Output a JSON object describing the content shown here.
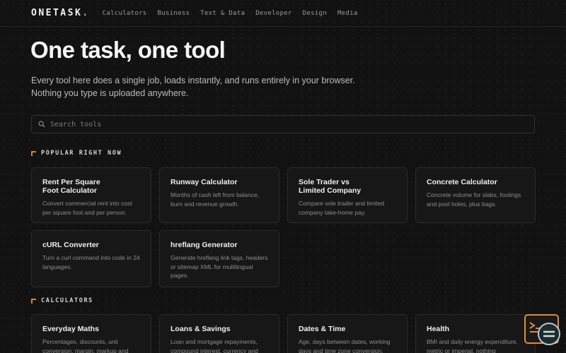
{
  "header": {
    "logo": "ONETASK",
    "logo_dot": ".",
    "nav": [
      "Calculators",
      "Business",
      "Text & Data",
      "Developer",
      "Design",
      "Media"
    ]
  },
  "hero": {
    "title": "One task, one tool",
    "subtitle": "Every tool here does a single job, loads instantly, and runs entirely in your browser. Nothing you type is uploaded anywhere."
  },
  "search": {
    "placeholder": "Search tools",
    "value": ""
  },
  "sections": [
    {
      "label": "POPULAR RIGHT NOW",
      "cards": [
        {
          "title": "Rent Per Square Foot Calculator",
          "desc": "Convert commercial rent into cost per square foot and per person."
        },
        {
          "title": "Runway Calculator",
          "desc": "Months of cash left from balance, burn and revenue growth."
        },
        {
          "title": "Sole Trader vs Limited Company",
          "desc": "Compare sole trader and limited company take-home pay."
        },
        {
          "title": "Concrete Calculator",
          "desc": "Concrete volume for slabs, footings and post holes, plus bags."
        },
        {
          "title": "cURL Converter",
          "desc": "Turn a curl command into code in 24 languages."
        },
        {
          "title": "hreflang Generator",
          "desc": "Generate hreflang link tags, headers or sitemap XML for multilingual pages."
        }
      ]
    },
    {
      "label": "CALCULATORS",
      "cards": [
        {
          "title": "Everyday Maths",
          "desc": "Percentages, discounts, unit conversion, margin, markup and"
        },
        {
          "title": "Loans & Savings",
          "desc": "Loan and mortgage repayments, compound interest, currency and"
        },
        {
          "title": "Dates & Time",
          "desc": "Age, days between dates, working days and time zone conversion."
        },
        {
          "title": "Health",
          "desc": "BMI and daily energy expenditure, metric or imperial, nothing"
        }
      ]
    }
  ],
  "colors": {
    "accent": "#d9823b",
    "background": "#121212",
    "card": "#181818"
  }
}
